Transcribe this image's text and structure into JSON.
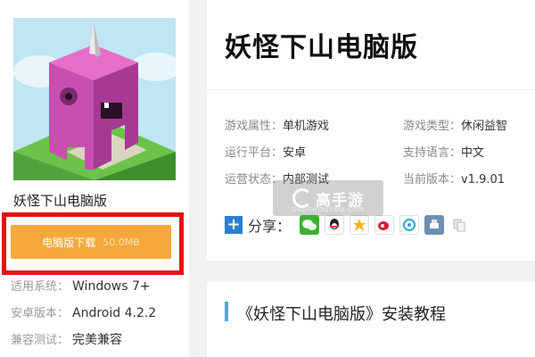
{
  "left": {
    "game_name": "妖怪下山电脑版",
    "download_label": "电脑版下载",
    "download_size": "50.0MB",
    "info": [
      {
        "label": "适用系统：",
        "value": "Windows 7+"
      },
      {
        "label": "安卓版本：",
        "value": "Android 4.2.2"
      },
      {
        "label": "兼容测试：",
        "value": "完美兼容"
      }
    ]
  },
  "main": {
    "title": "妖怪下山电脑版",
    "attrs": {
      "game_attr_label": "游戏属性：",
      "game_attr_value": "单机游戏",
      "game_type_label": "游戏类型：",
      "game_type_value": "休闲益智",
      "platform_label": "运行平台：",
      "platform_value": "安卓",
      "lang_label": "支持语言：",
      "lang_value": "中文",
      "status_label": "运营状态：",
      "status_value": "内部测试",
      "version_label": "当前版本：",
      "version_value": "v1.9.01"
    },
    "share_label": "分享："
  },
  "watermark": {
    "brand": "高手游",
    "domain": "GAOSHOUYOU.COM"
  },
  "section": {
    "title": "《妖怪下山电脑版》安装教程"
  },
  "colors": {
    "accent_orange": "#f5a93b",
    "highlight_red": "#e01414",
    "section_cyan": "#2bbbd8"
  }
}
